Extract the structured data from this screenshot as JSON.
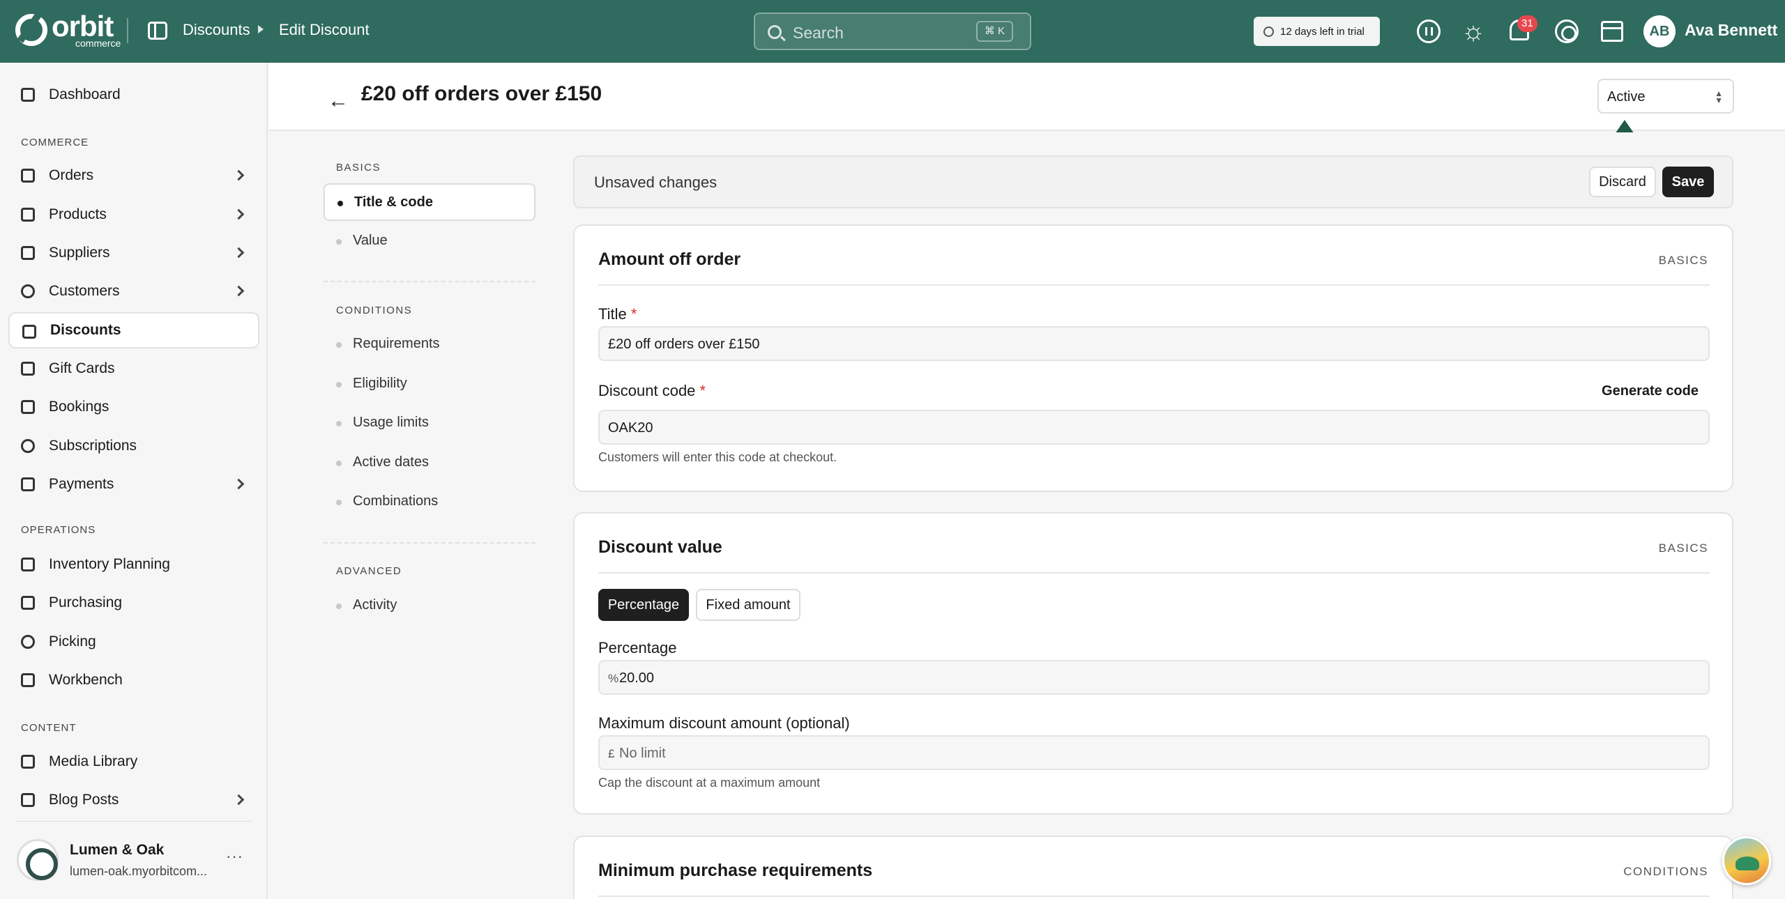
{
  "topbar": {
    "logo_word": "orbit",
    "logo_sub": "commerce",
    "breadcrumb": [
      "Discounts",
      "Edit Discount"
    ],
    "search_placeholder": "Search",
    "search_shortcut": "⌘ K",
    "trial_text": "12 days left in trial",
    "notification_count": "31",
    "user_initials": "AB",
    "user_name": "Ava Bennett",
    "brand_color": "#2f6b5e"
  },
  "sidebar": {
    "items": [
      {
        "label": "Dashboard",
        "icon": "dashboard-icon"
      },
      {
        "label": "Orders",
        "icon": "receipt-icon",
        "chevron": true
      },
      {
        "label": "Products",
        "icon": "box-icon",
        "chevron": true
      },
      {
        "label": "Suppliers",
        "icon": "building-icon",
        "chevron": true
      },
      {
        "label": "Customers",
        "icon": "users-icon",
        "chevron": true
      },
      {
        "label": "Discounts",
        "icon": "tag-icon",
        "active": true
      },
      {
        "label": "Gift Cards",
        "icon": "gift-icon"
      },
      {
        "label": "Bookings",
        "icon": "calendar-icon"
      },
      {
        "label": "Subscriptions",
        "icon": "refresh-icon"
      },
      {
        "label": "Payments",
        "icon": "credit-card-icon",
        "chevron": true
      },
      {
        "label": "Inventory Planning",
        "icon": "clipboard-icon"
      },
      {
        "label": "Purchasing",
        "icon": "box-icon"
      },
      {
        "label": "Picking",
        "icon": "map-pin-icon"
      },
      {
        "label": "Workbench",
        "icon": "box-icon"
      },
      {
        "label": "Media Library",
        "icon": "image-icon"
      },
      {
        "label": "Blog Posts",
        "icon": "book-icon",
        "chevron": true
      }
    ],
    "sections": [
      "COMMERCE",
      "OPERATIONS",
      "CONTENT"
    ],
    "store_name": "Lumen & Oak",
    "store_url": "lumen-oak.myorbitcom...",
    "more": "···"
  },
  "header": {
    "title": "£20 off orders over £150",
    "status": "Active"
  },
  "toc": {
    "sections": [
      {
        "label": "BASICS",
        "items": [
          "Title & code",
          "Value"
        ]
      },
      {
        "label": "CONDITIONS",
        "items": [
          "Requirements",
          "Eligibility",
          "Usage limits",
          "Active dates",
          "Combinations"
        ]
      },
      {
        "label": "ADVANCED",
        "items": [
          "Activity"
        ]
      }
    ],
    "active_item": "Title & code"
  },
  "unsaved_bar": {
    "text": "Unsaved changes",
    "discard_label": "Discard",
    "save_label": "Save"
  },
  "card_amount": {
    "title": "Amount off order",
    "tag": "BASICS",
    "title_label": "Title",
    "title_value": "£20 off orders over £150",
    "code_label": "Discount code",
    "generate_label": "Generate code",
    "code_value": "OAK20",
    "code_help": "Customers will enter this code at checkout.",
    "required_mark": "*"
  },
  "card_value": {
    "title": "Discount value",
    "tag": "BASICS",
    "type_options": [
      "Percentage",
      "Fixed amount"
    ],
    "selected_type": "Percentage",
    "percentage_label": "Percentage",
    "percentage_prefix": "%",
    "percentage_value": "20.00",
    "max_label": "Maximum discount amount (optional)",
    "max_prefix": "£",
    "max_placeholder": "No limit",
    "max_help": "Cap the discount at a maximum amount"
  },
  "card_min": {
    "title": "Minimum purchase requirements",
    "tag": "CONDITIONS"
  }
}
